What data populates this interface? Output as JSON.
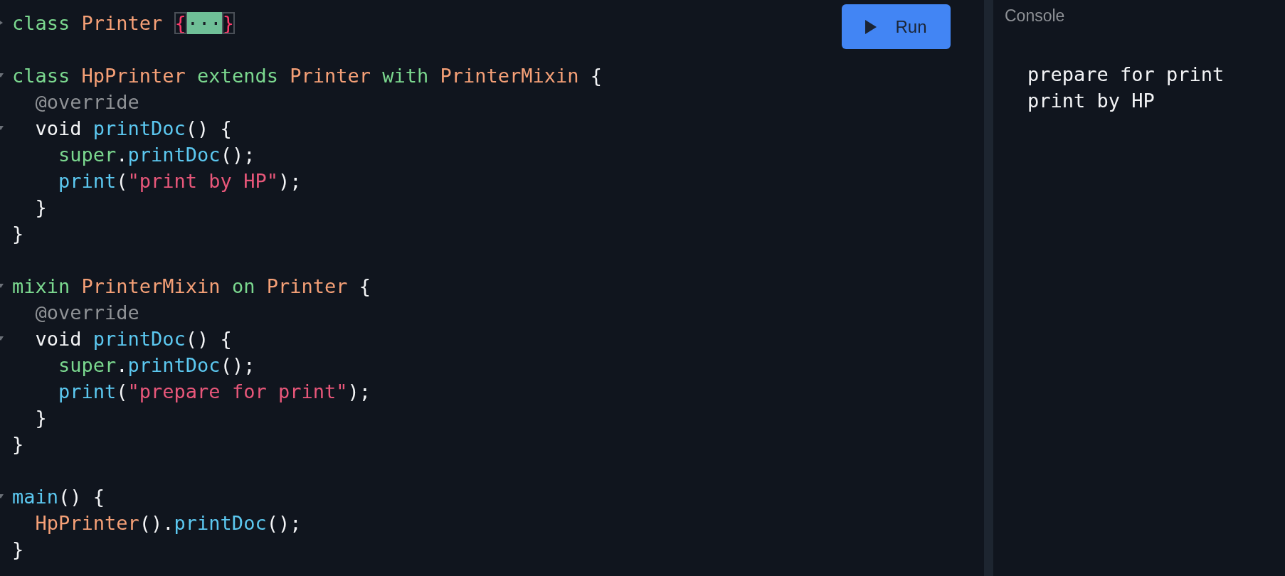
{
  "editor": {
    "run_button": {
      "label": "Run"
    },
    "blocks": [
      [
        {
          "fold_marker": {
            "expanded": false
          },
          "tokens": [
            {
              "kind": "keyword",
              "text": "class "
            },
            {
              "kind": "type",
              "text": "Printer "
            },
            {
              "kind": "fold-open",
              "text": "{"
            },
            {
              "kind": "fold-dots",
              "text": "···"
            },
            {
              "kind": "fold-close",
              "text": "}"
            }
          ]
        }
      ],
      [
        {
          "fold_marker": {
            "expanded": true
          },
          "tokens": [
            {
              "kind": "keyword",
              "text": "class "
            },
            {
              "kind": "type",
              "text": "HpPrinter "
            },
            {
              "kind": "keyword",
              "text": "extends "
            },
            {
              "kind": "type",
              "text": "Printer "
            },
            {
              "kind": "keyword",
              "text": "with "
            },
            {
              "kind": "type",
              "text": "PrinterMixin "
            },
            {
              "kind": "plain",
              "text": "{"
            }
          ]
        },
        {
          "tokens": [
            {
              "kind": "annotation",
              "text": "  @override"
            }
          ]
        },
        {
          "fold_marker": {
            "expanded": true
          },
          "tokens": [
            {
              "kind": "plain",
              "text": "  void "
            },
            {
              "kind": "func",
              "text": "printDoc"
            },
            {
              "kind": "plain",
              "text": "() {"
            }
          ]
        },
        {
          "tokens": [
            {
              "kind": "keyword",
              "text": "    super"
            },
            {
              "kind": "plain",
              "text": "."
            },
            {
              "kind": "func",
              "text": "printDoc"
            },
            {
              "kind": "plain",
              "text": "();"
            }
          ]
        },
        {
          "tokens": [
            {
              "kind": "func",
              "text": "    print"
            },
            {
              "kind": "plain",
              "text": "("
            },
            {
              "kind": "string",
              "text": "\"print by HP\""
            },
            {
              "kind": "plain",
              "text": ");"
            }
          ]
        },
        {
          "tokens": [
            {
              "kind": "plain",
              "text": "  }"
            }
          ]
        },
        {
          "tokens": [
            {
              "kind": "plain",
              "text": "}"
            }
          ]
        }
      ],
      [
        {
          "fold_marker": {
            "expanded": true
          },
          "tokens": [
            {
              "kind": "keyword",
              "text": "mixin "
            },
            {
              "kind": "type",
              "text": "PrinterMixin "
            },
            {
              "kind": "keyword",
              "text": "on "
            },
            {
              "kind": "type",
              "text": "Printer "
            },
            {
              "kind": "plain",
              "text": "{"
            }
          ]
        },
        {
          "tokens": [
            {
              "kind": "annotation",
              "text": "  @override"
            }
          ]
        },
        {
          "fold_marker": {
            "expanded": true
          },
          "tokens": [
            {
              "kind": "plain",
              "text": "  void "
            },
            {
              "kind": "func",
              "text": "printDoc"
            },
            {
              "kind": "plain",
              "text": "() {"
            }
          ]
        },
        {
          "tokens": [
            {
              "kind": "keyword",
              "text": "    super"
            },
            {
              "kind": "plain",
              "text": "."
            },
            {
              "kind": "func",
              "text": "printDoc"
            },
            {
              "kind": "plain",
              "text": "();"
            }
          ]
        },
        {
          "tokens": [
            {
              "kind": "func",
              "text": "    print"
            },
            {
              "kind": "plain",
              "text": "("
            },
            {
              "kind": "string",
              "text": "\"prepare for print\""
            },
            {
              "kind": "plain",
              "text": ");"
            }
          ]
        },
        {
          "tokens": [
            {
              "kind": "plain",
              "text": "  }"
            }
          ]
        },
        {
          "tokens": [
            {
              "kind": "plain",
              "text": "}"
            }
          ]
        }
      ],
      [
        {
          "fold_marker": {
            "expanded": true
          },
          "tokens": [
            {
              "kind": "func",
              "text": "main"
            },
            {
              "kind": "plain",
              "text": "() {"
            }
          ]
        },
        {
          "tokens": [
            {
              "kind": "type",
              "text": "  HpPrinter"
            },
            {
              "kind": "plain",
              "text": "()."
            },
            {
              "kind": "func",
              "text": "printDoc"
            },
            {
              "kind": "plain",
              "text": "();"
            }
          ]
        },
        {
          "tokens": [
            {
              "kind": "plain",
              "text": "}"
            }
          ]
        }
      ]
    ]
  },
  "console": {
    "title": "Console",
    "output": [
      "prepare for print",
      "print by HP"
    ]
  }
}
